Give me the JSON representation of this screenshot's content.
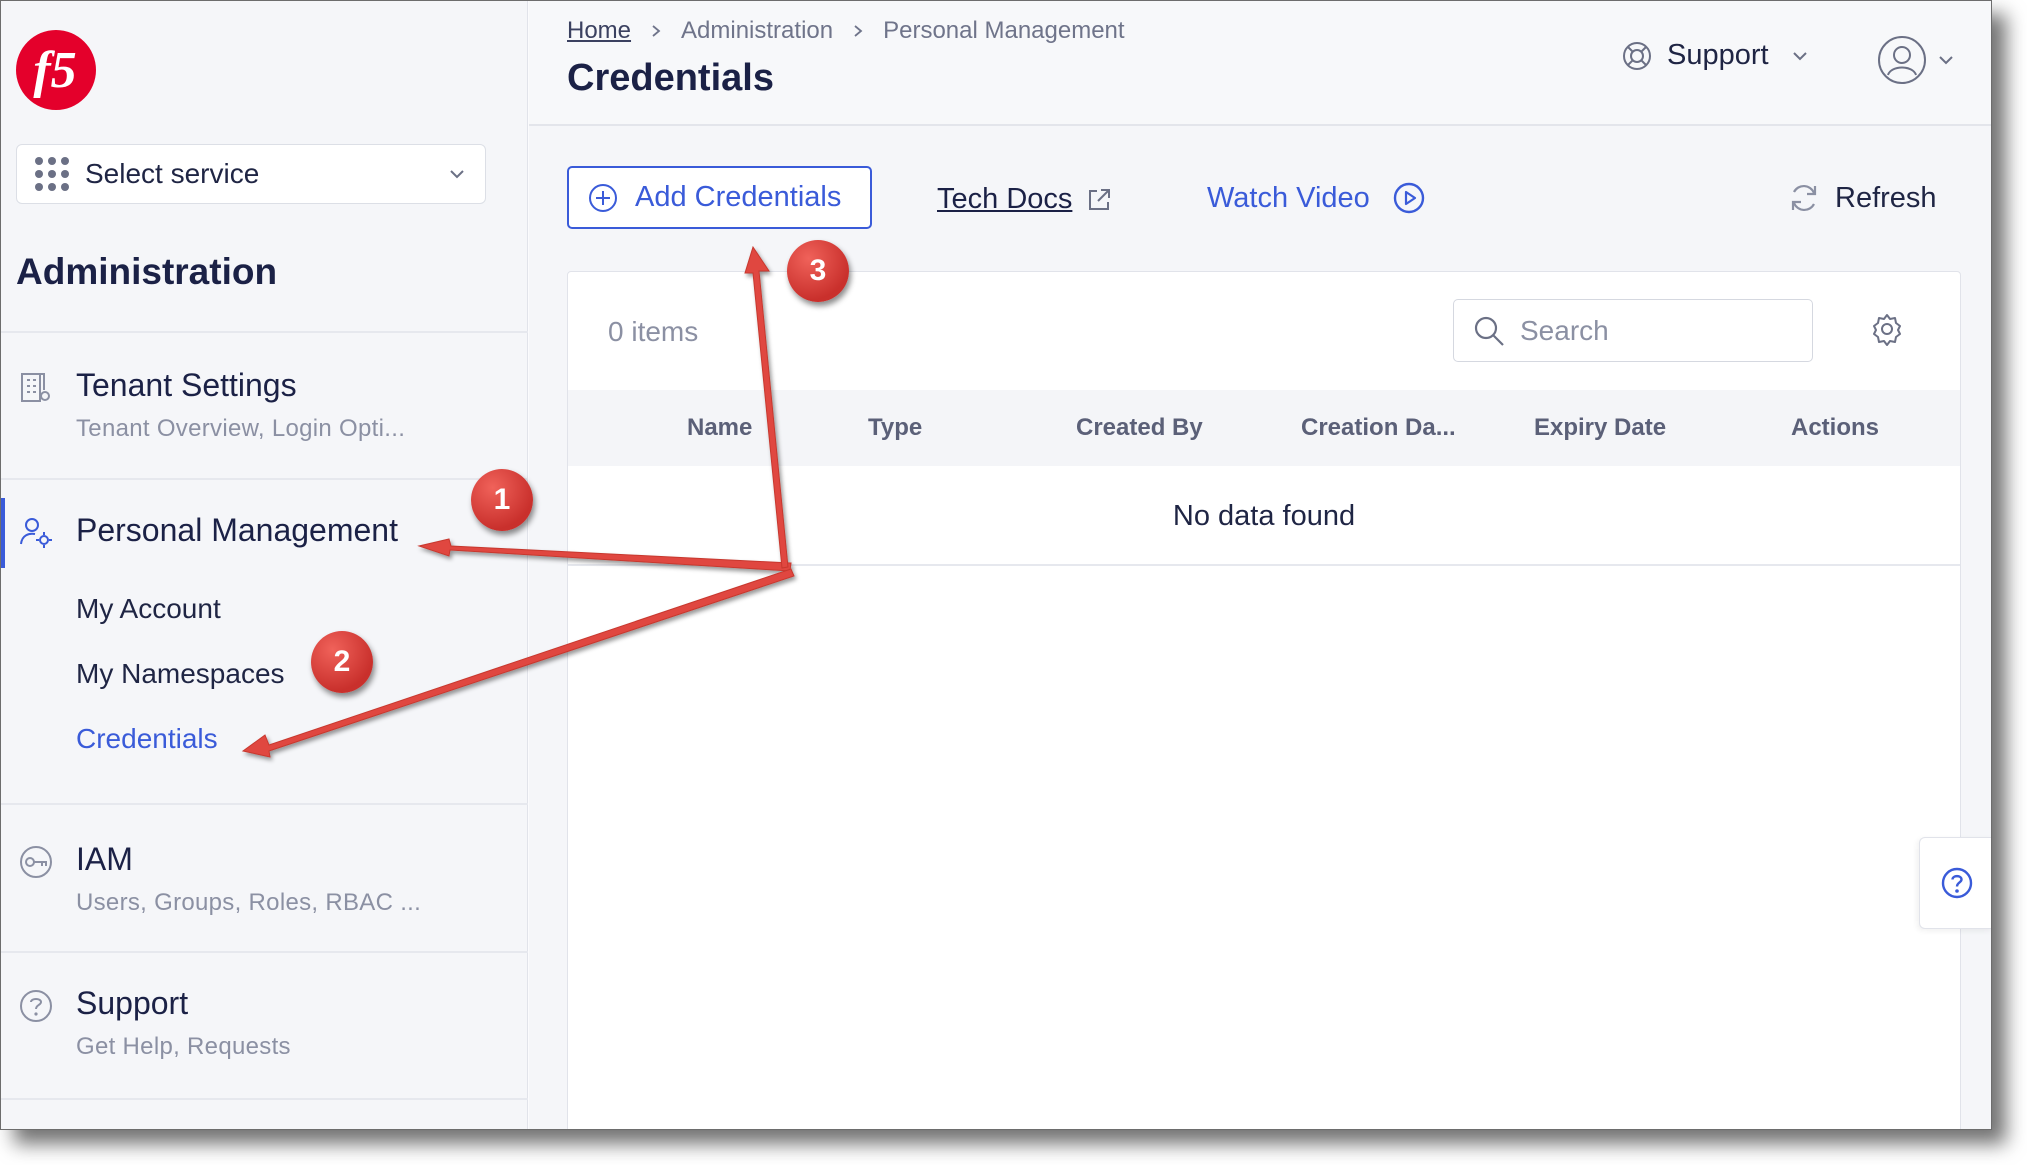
{
  "sidebar": {
    "service_select": {
      "label": "Select service"
    },
    "title": "Administration",
    "sections": {
      "tenant": {
        "title": "Tenant Settings",
        "subtitle": "Tenant Overview, Login Opti..."
      },
      "personal": {
        "title": "Personal Management",
        "children": [
          "My Account",
          "My Namespaces",
          "Credentials"
        ],
        "active_child": "Credentials"
      },
      "iam": {
        "title": "IAM",
        "subtitle": "Users, Groups, Roles, RBAC ..."
      },
      "support": {
        "title": "Support",
        "subtitle": "Get Help, Requests"
      }
    }
  },
  "header": {
    "breadcrumb": [
      "Home",
      "Administration",
      "Personal Management"
    ],
    "title": "Credentials",
    "support_label": "Support"
  },
  "toolbar": {
    "add_label": "Add Credentials",
    "docs_label": "Tech Docs",
    "video_label": "Watch Video",
    "refresh_label": "Refresh"
  },
  "table": {
    "count_label": "0 items",
    "search_placeholder": "Search",
    "columns": [
      "Name",
      "Type",
      "Created By",
      "Creation Da...",
      "Expiry Date",
      "Actions"
    ],
    "empty_message": "No data found"
  },
  "annotations": [
    "1",
    "2",
    "3"
  ],
  "colors": {
    "accent": "#3a5bd9",
    "annotation": "#e0473f",
    "logo": "#e4002b"
  }
}
